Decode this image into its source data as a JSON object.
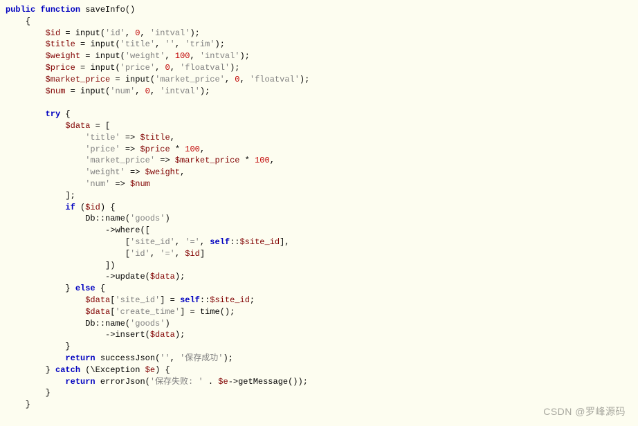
{
  "code": {
    "l1": {
      "public": "public",
      "function": "function",
      "name": "saveInfo",
      "parens": "()"
    },
    "l2": "    {",
    "l3": {
      "indent": "        ",
      "var": "$id",
      "eq": " = ",
      "fn": "input",
      "args": {
        "s1": "'id'",
        "c1": ", ",
        "n1": "0",
        "c2": ", ",
        "s2": "'intval'"
      },
      "end": ");"
    },
    "l4": {
      "indent": "        ",
      "var": "$title",
      "eq": " = ",
      "fn": "input",
      "args": {
        "s1": "'title'",
        "c1": ", ",
        "s2": "''",
        "c2": ", ",
        "s3": "'trim'"
      },
      "end": ");"
    },
    "l5": {
      "indent": "        ",
      "var": "$weight",
      "eq": " = ",
      "fn": "input",
      "args": {
        "s1": "'weight'",
        "c1": ", ",
        "n1": "100",
        "c2": ", ",
        "s2": "'intval'"
      },
      "end": ");"
    },
    "l6": {
      "indent": "        ",
      "var": "$price",
      "eq": " = ",
      "fn": "input",
      "args": {
        "s1": "'price'",
        "c1": ", ",
        "n1": "0",
        "c2": ", ",
        "s2": "'floatval'"
      },
      "end": ");"
    },
    "l7": {
      "indent": "        ",
      "var": "$market_price",
      "eq": " = ",
      "fn": "input",
      "args": {
        "s1": "'market_price'",
        "c1": ", ",
        "n1": "0",
        "c2": ", ",
        "s2": "'floatval'"
      },
      "end": ");"
    },
    "l8": {
      "indent": "        ",
      "var": "$num",
      "eq": " = ",
      "fn": "input",
      "args": {
        "s1": "'num'",
        "c1": ", ",
        "n1": "0",
        "c2": ", ",
        "s2": "'intval'"
      },
      "end": ");"
    },
    "l9": "",
    "l10": {
      "indent": "        ",
      "kw": "try",
      "rest": " {"
    },
    "l11": {
      "indent": "            ",
      "var": "$data",
      "rest": " = ["
    },
    "l12": {
      "indent": "                ",
      "s": "'title'",
      "arrow": " => ",
      "var": "$title",
      "rest": ","
    },
    "l13": {
      "indent": "                ",
      "s": "'price'",
      "arrow": " => ",
      "var": "$price",
      "op": " * ",
      "num": "100",
      "rest": ","
    },
    "l14": {
      "indent": "                ",
      "s": "'market_price'",
      "arrow": " => ",
      "var": "$market_price",
      "op": " * ",
      "num": "100",
      "rest": ","
    },
    "l15": {
      "indent": "                ",
      "s": "'weight'",
      "arrow": " => ",
      "var": "$weight",
      "rest": ","
    },
    "l16": {
      "indent": "                ",
      "s": "'num'",
      "arrow": " => ",
      "var": "$num"
    },
    "l17": "            ];",
    "l18": {
      "indent": "            ",
      "kw": "if",
      "sp": " (",
      "var": "$id",
      "rest": ") {"
    },
    "l19": {
      "indent": "                ",
      "cls": "Db",
      "dcolon": "::",
      "fn": "name",
      "open": "(",
      "s": "'goods'",
      "close": ")"
    },
    "l20": {
      "indent": "                    ->",
      "fn": "where",
      "rest": "(["
    },
    "l21": {
      "indent": "                        [",
      "s1": "'site_id'",
      "c1": ", ",
      "s2": "'='",
      "c2": ", ",
      "kw": "self",
      "dcolon": "::",
      "var": "$site_id",
      "rest": "],"
    },
    "l22": {
      "indent": "                        [",
      "s1": "'id'",
      "c1": ", ",
      "s2": "'='",
      "c2": ", ",
      "var": "$id",
      "rest": "]"
    },
    "l23": "                    ])",
    "l24": {
      "indent": "                    ->",
      "fn": "update",
      "open": "(",
      "var": "$data",
      "close": ");"
    },
    "l25": {
      "indent": "            } ",
      "kw": "else",
      "rest": " {"
    },
    "l26": {
      "indent": "                ",
      "var": "$data",
      "open": "[",
      "s": "'site_id'",
      "close": "] = ",
      "kw": "self",
      "dcolon": "::",
      "var2": "$site_id",
      "rest": ";"
    },
    "l27": {
      "indent": "                ",
      "var": "$data",
      "open": "[",
      "s": "'create_time'",
      "close": "] = ",
      "fn": "time",
      "rest": "();"
    },
    "l28": {
      "indent": "                ",
      "cls": "Db",
      "dcolon": "::",
      "fn": "name",
      "open": "(",
      "s": "'goods'",
      "close": ")"
    },
    "l29": {
      "indent": "                    ->",
      "fn": "insert",
      "open": "(",
      "var": "$data",
      "close": ");"
    },
    "l30": "            }",
    "l31": {
      "indent": "            ",
      "kw": "return",
      "sp": " ",
      "fn": "successJson",
      "open": "(",
      "s1": "''",
      "c1": ", ",
      "s2": "'保存成功'",
      "close": ");"
    },
    "l32": {
      "indent": "        } ",
      "kw": "catch",
      "sp": " (\\",
      "cls": "Exception",
      "sp2": " ",
      "var": "$e",
      "rest": ") {"
    },
    "l33": {
      "indent": "            ",
      "kw": "return",
      "sp": " ",
      "fn": "errorJson",
      "open": "(",
      "s1": "'保存失败: '",
      "op": " . ",
      "var": "$e",
      "arrow": "->",
      "fn2": "getMessage",
      "close": "());"
    },
    "l34": "        }",
    "l35": "    }"
  },
  "watermark": "CSDN @罗峰源码"
}
